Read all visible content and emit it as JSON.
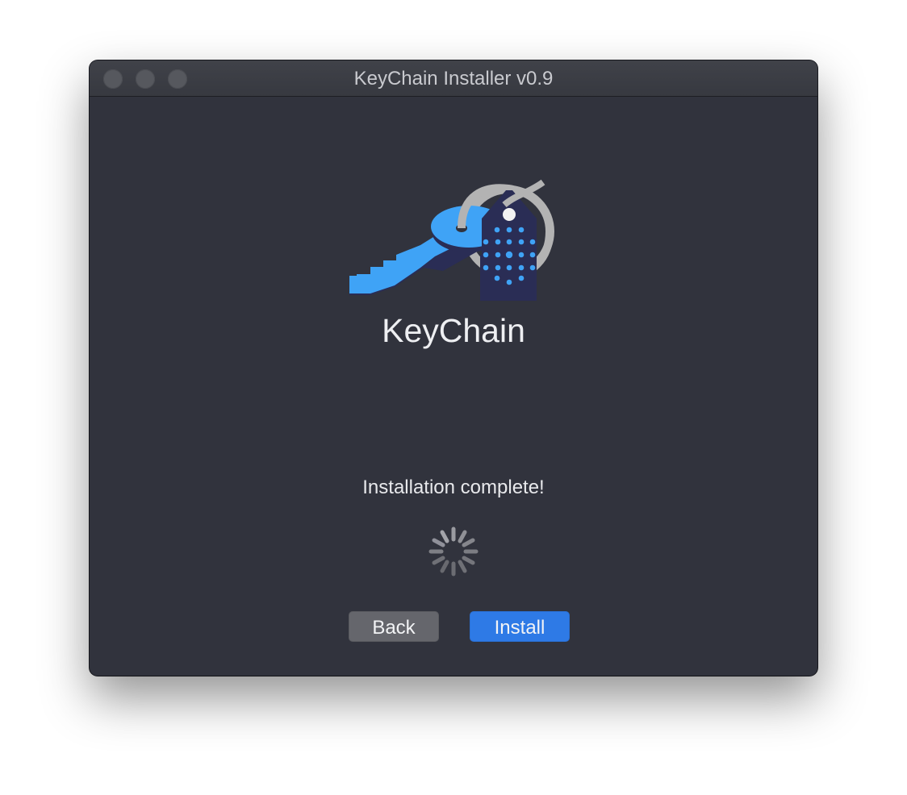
{
  "window": {
    "title": "KeyChain Installer v0.9"
  },
  "main": {
    "app_name": "KeyChain",
    "status_text": "Installation complete!",
    "logo_icon": "keychain-logo-icon",
    "spinner_icon": "loading-spinner-icon"
  },
  "buttons": {
    "back_label": "Back",
    "install_label": "Install"
  },
  "colors": {
    "window_background": "#31333d",
    "accent": "#2e7ae6",
    "key_blue": "#3fa3f6",
    "tag_navy": "#2a2d55"
  }
}
